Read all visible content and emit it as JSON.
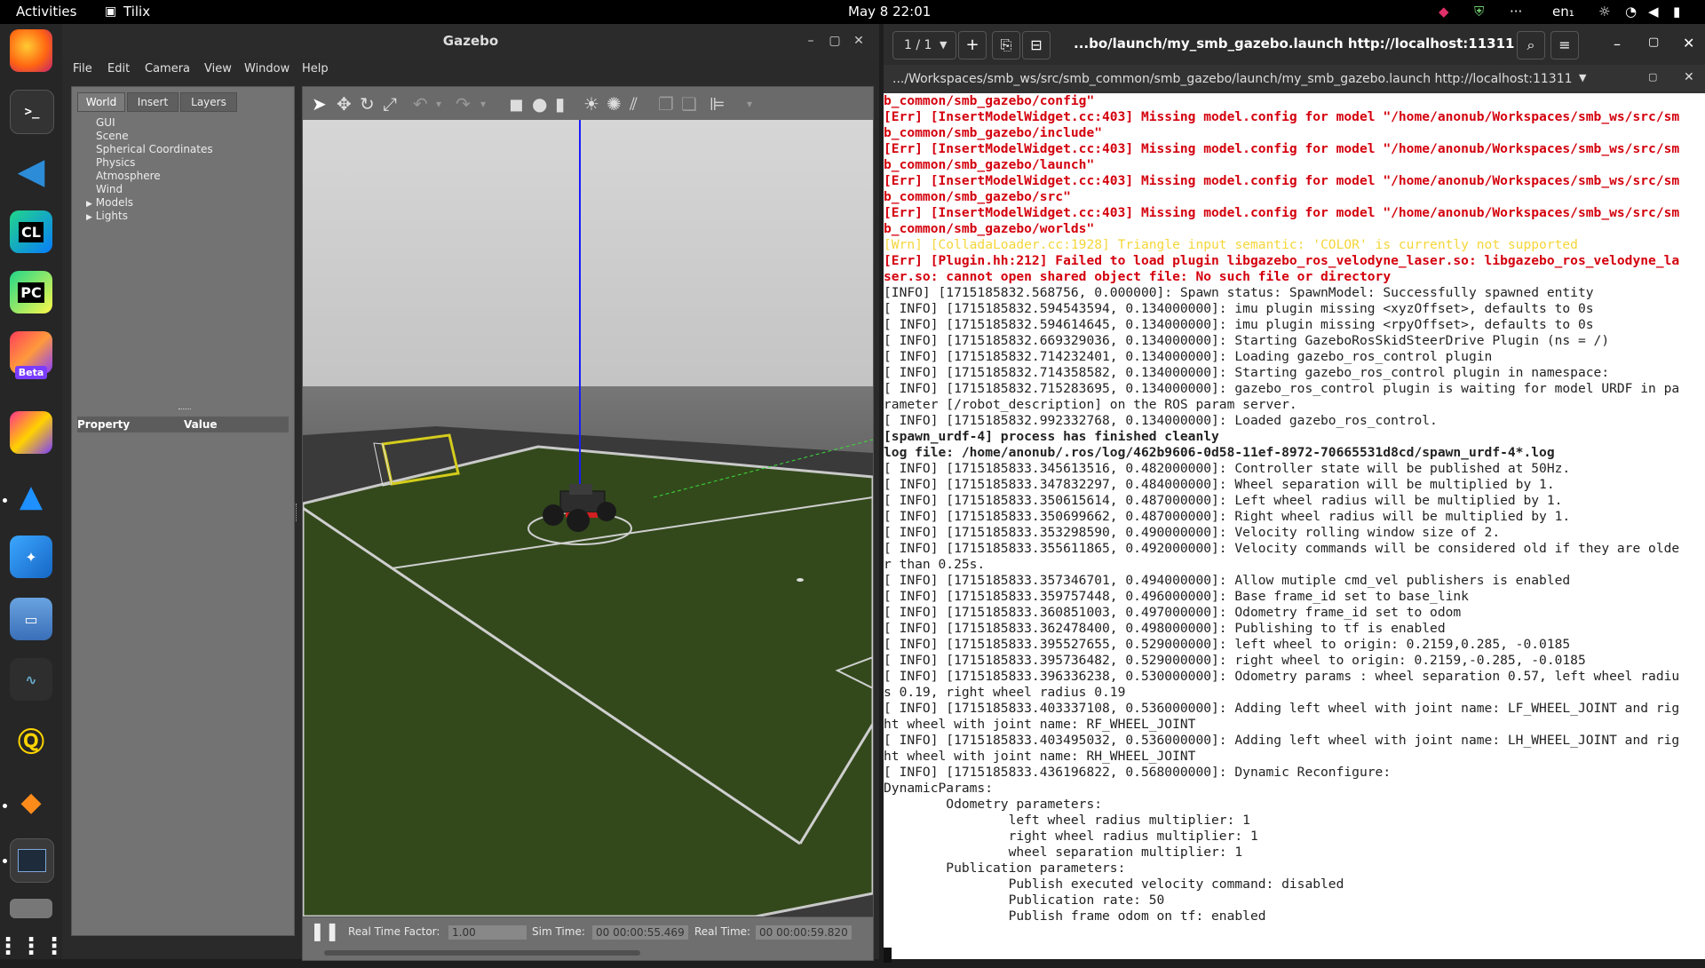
{
  "topbar": {
    "activities": "Activities",
    "app": "Tilix",
    "clock": "May 8  22:01",
    "dots": "···",
    "lang": "en₁"
  },
  "dock": {
    "items": [
      "firefox-icon",
      "terminal-icon",
      "vscode-icon",
      "clion-icon",
      "pycharm-icon",
      "fleet-icon",
      "ide-icon",
      "blue-app-icon",
      "lens-icon",
      "files-icon",
      "system-monitor-icon",
      "qgroundcontrol-icon",
      "blender-icon",
      "tilix-icon",
      "disk-icon",
      "app-grid-icon"
    ],
    "clion": "CL",
    "pycharm": "PC",
    "beta": "Beta"
  },
  "gazebo": {
    "title": "Gazebo",
    "menu": [
      "File",
      "Edit",
      "Camera",
      "View",
      "Window",
      "Help"
    ],
    "tabs": [
      "World",
      "Insert",
      "Layers"
    ],
    "tree": [
      "GUI",
      "Scene",
      "Spherical Coordinates",
      "Physics",
      "Atmosphere",
      "Wind",
      "Models",
      "Lights"
    ],
    "prop_header": {
      "property": "Property",
      "value": "Value"
    },
    "status": {
      "rtf_label": "Real Time Factor:",
      "rtf": "1.00",
      "sim_label": "Sim Time:",
      "sim": "00 00:00:55.469",
      "real_label": "Real Time:",
      "real": "00 00:00:59.820"
    }
  },
  "terminal": {
    "counter": "1 / 1",
    "title": "...bo/launch/my_smb_gazebo.launch http://localhost:11311",
    "tab_title": ".../Workspaces/smb_ws/src/smb_common/smb_gazebo/launch/my_smb_gazebo.launch http://localhost:11311",
    "lines": [
      {
        "t": "b_common/smb_gazebo/config\"",
        "c": "err"
      },
      {
        "t": "[Err] [InsertModelWidget.cc:403] Missing model.config for model \"/home/anonub/Workspaces/smb_ws/src/sm",
        "c": "err"
      },
      {
        "t": "b_common/smb_gazebo/include\"",
        "c": "err"
      },
      {
        "t": "[Err] [InsertModelWidget.cc:403] Missing model.config for model \"/home/anonub/Workspaces/smb_ws/src/sm",
        "c": "err"
      },
      {
        "t": "b_common/smb_gazebo/launch\"",
        "c": "err"
      },
      {
        "t": "[Err] [InsertModelWidget.cc:403] Missing model.config for model \"/home/anonub/Workspaces/smb_ws/src/sm",
        "c": "err"
      },
      {
        "t": "b_common/smb_gazebo/src\"",
        "c": "err"
      },
      {
        "t": "[Err] [InsertModelWidget.cc:403] Missing model.config for model \"/home/anonub/Workspaces/smb_ws/src/sm",
        "c": "err"
      },
      {
        "t": "b_common/smb_gazebo/worlds\"",
        "c": "err"
      },
      {
        "t": "[Wrn] [ColladaLoader.cc:1928] Triangle input semantic: 'COLOR' is currently not supported",
        "c": "wrn"
      },
      {
        "t": "[Err] [Plugin.hh:212] Failed to load plugin libgazebo_ros_velodyne_laser.so: libgazebo_ros_velodyne_la",
        "c": "err"
      },
      {
        "t": "ser.so: cannot open shared object file: No such file or directory",
        "c": "err"
      },
      {
        "t": "[INFO] [1715185832.568756, 0.000000]: Spawn status: SpawnModel: Successfully spawned entity",
        "c": ""
      },
      {
        "t": "[ INFO] [1715185832.594543594, 0.134000000]: imu plugin missing <xyzOffset>, defaults to 0s",
        "c": ""
      },
      {
        "t": "[ INFO] [1715185832.594614645, 0.134000000]: imu plugin missing <rpyOffset>, defaults to 0s",
        "c": ""
      },
      {
        "t": "[ INFO] [1715185832.669329036, 0.134000000]: Starting GazeboRosSkidSteerDrive Plugin (ns = /)",
        "c": ""
      },
      {
        "t": "[ INFO] [1715185832.714232401, 0.134000000]: Loading gazebo_ros_control plugin",
        "c": ""
      },
      {
        "t": "[ INFO] [1715185832.714358582, 0.134000000]: Starting gazebo_ros_control plugin in namespace:",
        "c": ""
      },
      {
        "t": "[ INFO] [1715185832.715283695, 0.134000000]: gazebo_ros_control plugin is waiting for model URDF in pa",
        "c": ""
      },
      {
        "t": "rameter [/robot_description] on the ROS param server.",
        "c": ""
      },
      {
        "t": "[ INFO] [1715185832.992332768, 0.134000000]: Loaded gazebo_ros_control.",
        "c": ""
      },
      {
        "t": "[spawn_urdf-4] process has finished cleanly",
        "c": "bold"
      },
      {
        "t": "log file: /home/anonub/.ros/log/462b9606-0d58-11ef-8972-70665531d8cd/spawn_urdf-4*.log",
        "c": "bold"
      },
      {
        "t": "[ INFO] [1715185833.345613516, 0.482000000]: Controller state will be published at 50Hz.",
        "c": ""
      },
      {
        "t": "[ INFO] [1715185833.347832297, 0.484000000]: Wheel separation will be multiplied by 1.",
        "c": ""
      },
      {
        "t": "[ INFO] [1715185833.350615614, 0.487000000]: Left wheel radius will be multiplied by 1.",
        "c": ""
      },
      {
        "t": "[ INFO] [1715185833.350699662, 0.487000000]: Right wheel radius will be multiplied by 1.",
        "c": ""
      },
      {
        "t": "[ INFO] [1715185833.353298590, 0.490000000]: Velocity rolling window size of 2.",
        "c": ""
      },
      {
        "t": "[ INFO] [1715185833.355611865, 0.492000000]: Velocity commands will be considered old if they are olde",
        "c": ""
      },
      {
        "t": "r than 0.25s.",
        "c": ""
      },
      {
        "t": "[ INFO] [1715185833.357346701, 0.494000000]: Allow mutiple cmd_vel publishers is enabled",
        "c": ""
      },
      {
        "t": "[ INFO] [1715185833.359757448, 0.496000000]: Base frame_id set to base_link",
        "c": ""
      },
      {
        "t": "[ INFO] [1715185833.360851003, 0.497000000]: Odometry frame_id set to odom",
        "c": ""
      },
      {
        "t": "[ INFO] [1715185833.362478400, 0.498000000]: Publishing to tf is enabled",
        "c": ""
      },
      {
        "t": "[ INFO] [1715185833.395527655, 0.529000000]: left wheel to origin: 0.2159,0.285, -0.0185",
        "c": ""
      },
      {
        "t": "[ INFO] [1715185833.395736482, 0.529000000]: right wheel to origin: 0.2159,-0.285, -0.0185",
        "c": ""
      },
      {
        "t": "[ INFO] [1715185833.396336238, 0.530000000]: Odometry params : wheel separation 0.57, left wheel radiu",
        "c": ""
      },
      {
        "t": "s 0.19, right wheel radius 0.19",
        "c": ""
      },
      {
        "t": "[ INFO] [1715185833.403337108, 0.536000000]: Adding left wheel with joint name: LF_WHEEL_JOINT and rig",
        "c": ""
      },
      {
        "t": "ht wheel with joint name: RF_WHEEL_JOINT",
        "c": ""
      },
      {
        "t": "[ INFO] [1715185833.403495032, 0.536000000]: Adding left wheel with joint name: LH_WHEEL_JOINT and rig",
        "c": ""
      },
      {
        "t": "ht wheel with joint name: RH_WHEEL_JOINT",
        "c": ""
      },
      {
        "t": "[ INFO] [1715185833.436196822, 0.568000000]: Dynamic Reconfigure:",
        "c": ""
      },
      {
        "t": "DynamicParams:",
        "c": ""
      },
      {
        "t": "        Odometry parameters:",
        "c": ""
      },
      {
        "t": "                left wheel radius multiplier: 1",
        "c": ""
      },
      {
        "t": "                right wheel radius multiplier: 1",
        "c": ""
      },
      {
        "t": "                wheel separation multiplier: 1",
        "c": ""
      },
      {
        "t": "        Publication parameters:",
        "c": ""
      },
      {
        "t": "                Publish executed velocity command: disabled",
        "c": ""
      },
      {
        "t": "                Publication rate: 50",
        "c": ""
      },
      {
        "t": "                Publish frame odom on tf: enabled",
        "c": ""
      }
    ]
  }
}
